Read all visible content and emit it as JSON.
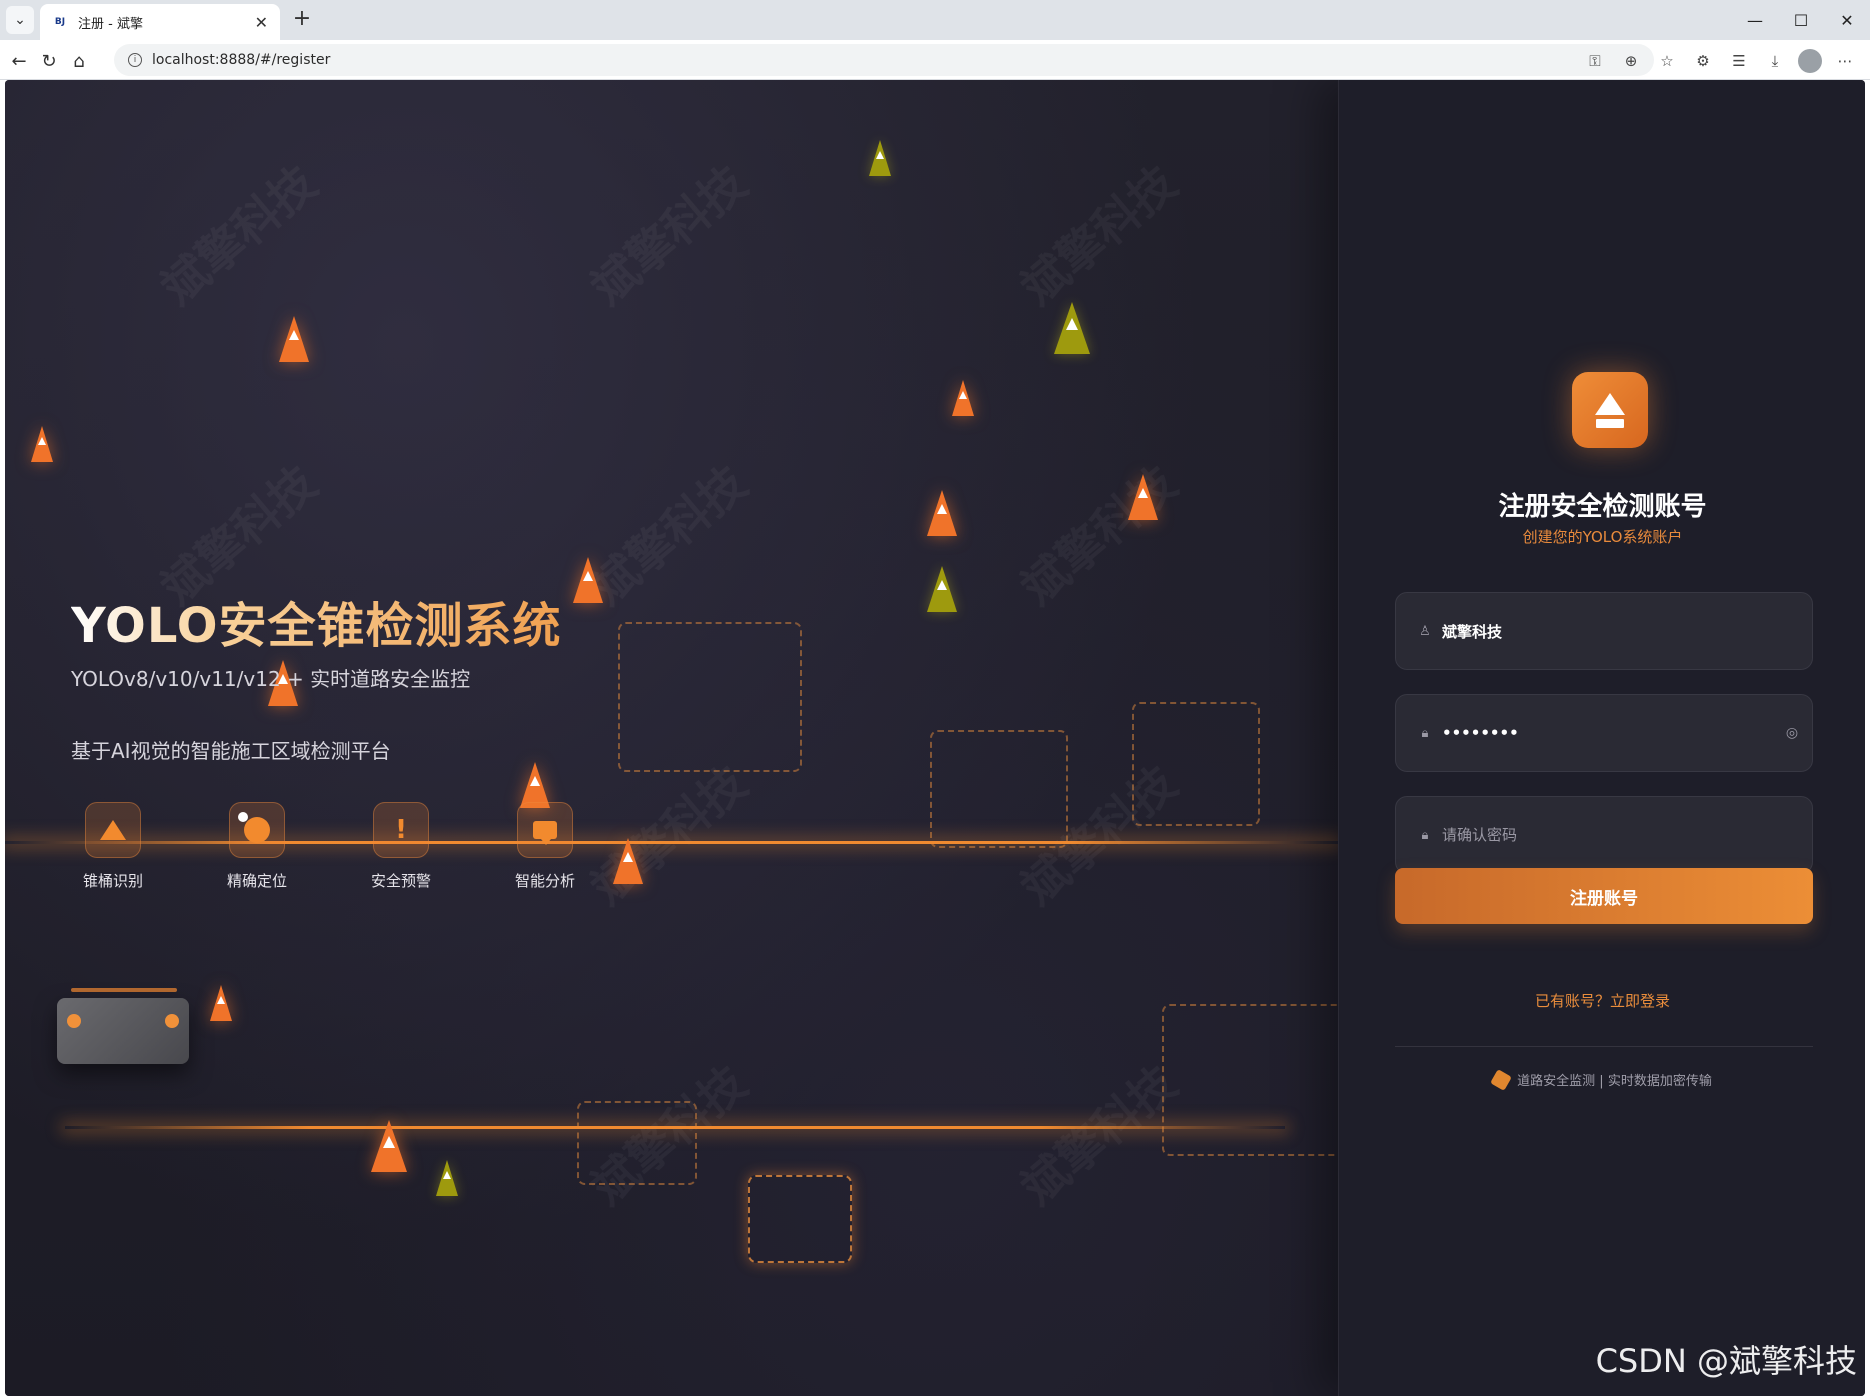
{
  "browser": {
    "tab_title": "注册 - 斌擎",
    "favicon_text": "BJ",
    "url": "localhost:8888/#/register"
  },
  "hero": {
    "title": "YOLO安全锥检测系统",
    "subtitle": "YOLOv8/v10/v11/v12 + 实时道路安全监控",
    "description": "基于AI视觉的智能施工区域检测平台",
    "watermark_text": "斌擎科技",
    "features": [
      {
        "label": "锥桶识别",
        "icon": "cone-icon"
      },
      {
        "label": "精确定位",
        "icon": "location-dot-icon"
      },
      {
        "label": "安全预警",
        "icon": "warning-icon"
      },
      {
        "label": "智能分析",
        "icon": "chat-icon"
      }
    ]
  },
  "register": {
    "title": "注册安全检测账号",
    "subtitle": "创建您的YOLO系统账户",
    "username_value": "斌擎科技",
    "password_value": "••••••••",
    "confirm_placeholder": "请确认密码",
    "submit_label": "注册账号",
    "login_link": "已有账号？立即登录",
    "footer_note": "道路安全监测 | 实时数据加密传输"
  },
  "overlay_watermark": "CSDN @斌擎科技",
  "colors": {
    "accent": "#ec8e36",
    "background": "#1d1c26",
    "panel": "#1e1e29"
  }
}
